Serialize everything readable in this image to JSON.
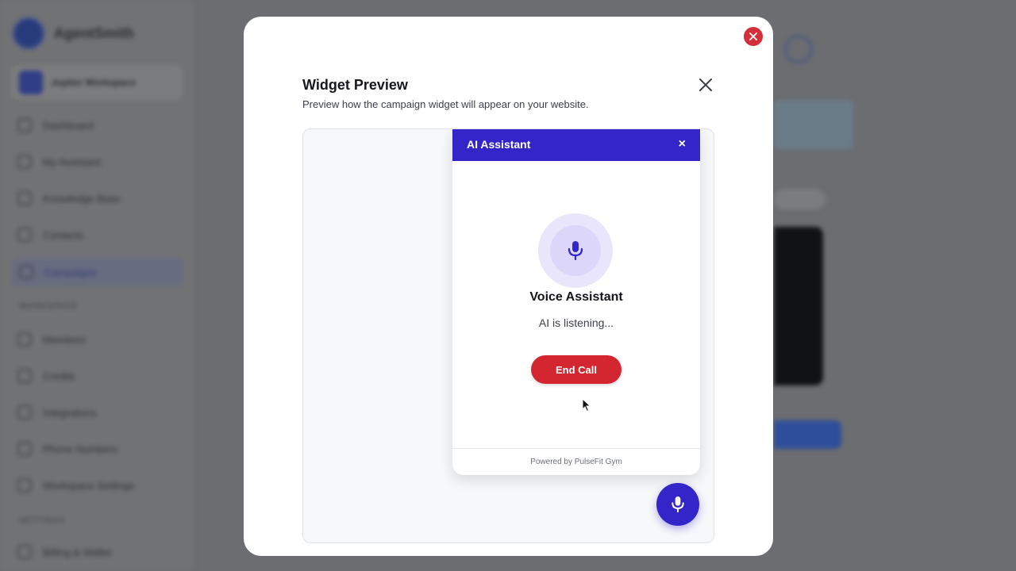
{
  "background": {
    "sidebar_nav": [
      "Dashboard",
      "My Assistant",
      "Knowledge Base",
      "Contacts",
      "Campaigns",
      "Members",
      "Credits",
      "Integrations",
      "Phone Numbers",
      "Workspace Settings",
      "Billing & Wallet"
    ],
    "active_nav": "Campaigns",
    "sections": [
      "WORKSPACE",
      "SETTINGS"
    ]
  },
  "modal": {
    "title": "Widget Preview",
    "subtitle": "Preview how the campaign widget will appear on your website."
  },
  "widget": {
    "header_title": "AI Assistant",
    "close_glyph": "×",
    "assistant_title": "Voice Assistant",
    "status_text": "AI is listening...",
    "end_call_label": "End Call",
    "footer_text": "Powered by PulseFit Gym"
  },
  "colors": {
    "brand": "#3425c9",
    "danger": "#d32630"
  },
  "icons": [
    "close-icon",
    "microphone-icon",
    "cursor-icon"
  ]
}
